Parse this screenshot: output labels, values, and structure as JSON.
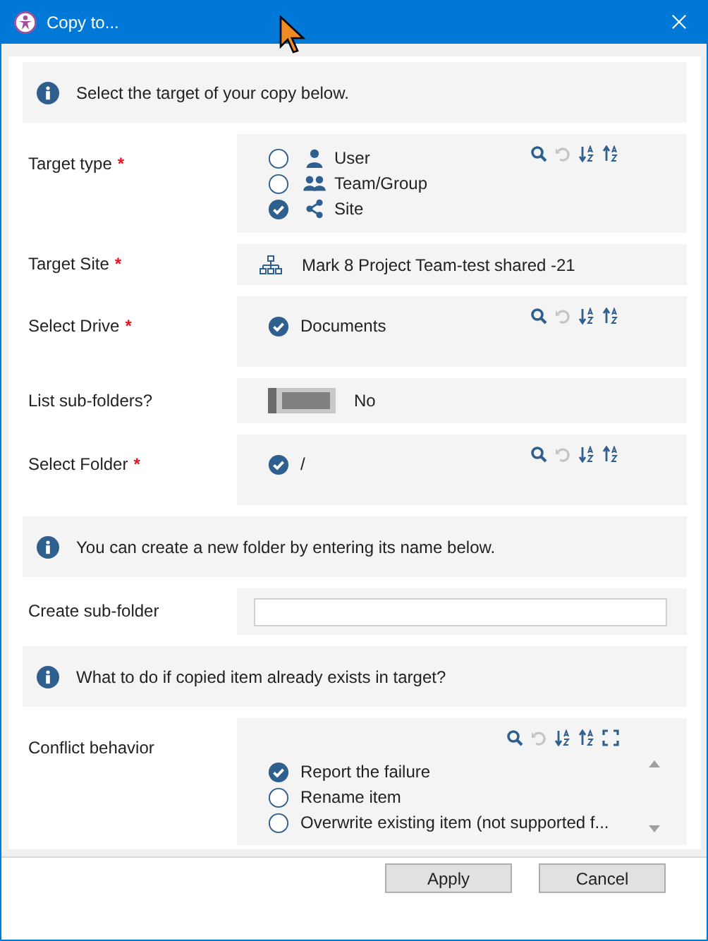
{
  "window": {
    "title": "Copy to..."
  },
  "sections": [
    {
      "kind": "info",
      "text": "Select the target of your copy below."
    },
    {
      "kind": "choice",
      "label": "Target type",
      "required_mark": "*",
      "toolbar": {
        "undo_enabled": false,
        "expand": false
      },
      "scrollbar": false,
      "options": [
        {
          "label": "User",
          "kind": "user",
          "selected": false
        },
        {
          "label": "Team/Group",
          "kind": "group",
          "selected": false
        },
        {
          "label": "Site",
          "kind": "site",
          "selected": true
        }
      ]
    },
    {
      "kind": "value",
      "label": "Target Site",
      "required_mark": "*",
      "value": "Mark 8 Project Team-test shared -21"
    },
    {
      "kind": "choice",
      "label": "Select Drive",
      "required_mark": "*",
      "toolbar": {
        "undo_enabled": false,
        "expand": false
      },
      "scrollbar": false,
      "options": [
        {
          "label": "Documents",
          "selected": true
        }
      ]
    },
    {
      "kind": "toggle",
      "label": "List sub-folders?",
      "on": false,
      "state_text": "No"
    },
    {
      "kind": "choice",
      "label": "Select Folder",
      "required_mark": "*",
      "toolbar": {
        "undo_enabled": false,
        "expand": false
      },
      "scrollbar": false,
      "options": [
        {
          "label": "/",
          "selected": true
        }
      ]
    },
    {
      "kind": "info",
      "text": "You can create a new folder by entering its name below."
    },
    {
      "kind": "input",
      "label": "Create sub-folder"
    },
    {
      "kind": "info",
      "text": "What to do if copied item already exists in target?"
    },
    {
      "kind": "choice",
      "label": "Conflict behavior",
      "toolbar": {
        "undo_enabled": false,
        "expand": true
      },
      "scrollbar": true,
      "options": [
        {
          "label": "Report the failure",
          "selected": true
        },
        {
          "label": "Rename item",
          "selected": false
        },
        {
          "label": "Overwrite existing item (not supported f...",
          "selected": false
        }
      ]
    }
  ],
  "buttons": [
    "Apply",
    "Cancel"
  ]
}
